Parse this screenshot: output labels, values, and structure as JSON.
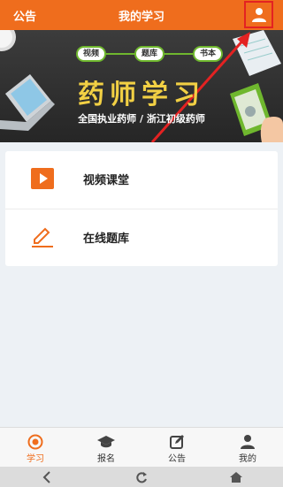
{
  "header": {
    "left_label": "公告",
    "title": "我的学习",
    "profile_icon": "user-icon"
  },
  "banner": {
    "tags": [
      "视频",
      "题库",
      "书本"
    ],
    "headline": "药师学习",
    "subline": "全国执业药师 / 浙江初级药师"
  },
  "menu": {
    "items": [
      {
        "label": "视频课堂",
        "icon": "video-play-icon"
      },
      {
        "label": "在线题库",
        "icon": "pencil-icon"
      }
    ]
  },
  "bottom_nav": {
    "items": [
      {
        "label": "学习",
        "icon": "target-icon",
        "active": true
      },
      {
        "label": "报名",
        "icon": "graduation-cap-icon",
        "active": false
      },
      {
        "label": "公告",
        "icon": "edit-icon",
        "active": false
      },
      {
        "label": "我的",
        "icon": "user-icon",
        "active": false
      }
    ]
  },
  "colors": {
    "accent": "#ef6d1d",
    "highlight": "#e32222",
    "banner_text": "#f2d044",
    "banner_tag_border": "#6fb72e"
  }
}
